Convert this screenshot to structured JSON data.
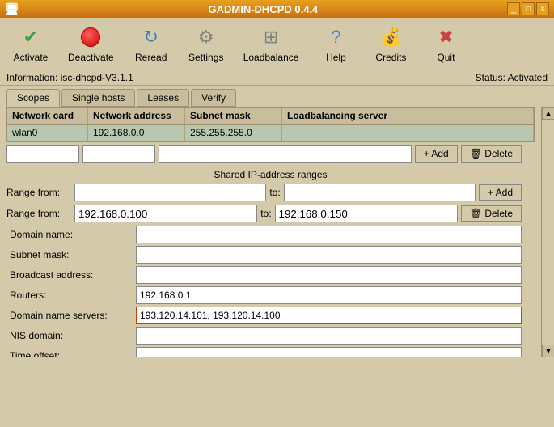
{
  "window": {
    "title": "GADMIN-DHCPD 0.4.4",
    "controls": [
      "_",
      "□",
      "×"
    ]
  },
  "toolbar": {
    "buttons": [
      {
        "id": "activate",
        "label": "Activate",
        "icon": "✔"
      },
      {
        "id": "deactivate",
        "label": "Deactivate",
        "icon": "●"
      },
      {
        "id": "reread",
        "label": "Reread",
        "icon": "↻"
      },
      {
        "id": "settings",
        "label": "Settings",
        "icon": "⚙"
      },
      {
        "id": "loadbalance",
        "label": "Loadbalance",
        "icon": "⊞"
      },
      {
        "id": "help",
        "label": "Help",
        "icon": "?"
      },
      {
        "id": "credits",
        "label": "Credits",
        "icon": "¤"
      },
      {
        "id": "quit",
        "label": "Quit",
        "icon": "✖"
      }
    ]
  },
  "status": {
    "left": "Information: isc-dhcpd-V3.1.1",
    "right": "Status: Activated"
  },
  "tabs": [
    {
      "id": "scopes",
      "label": "Scopes",
      "active": true
    },
    {
      "id": "single-hosts",
      "label": "Single hosts"
    },
    {
      "id": "leases",
      "label": "Leases"
    },
    {
      "id": "verify",
      "label": "Verify"
    }
  ],
  "table": {
    "headers": [
      "Network card",
      "Network address",
      "Subnet mask",
      "Loadbalancing server"
    ],
    "rows": [
      {
        "card": "wlan0",
        "address": "192.168.0.0",
        "mask": "255.255.255.0",
        "server": ""
      }
    ]
  },
  "form": {
    "input1_placeholder": "",
    "input2_placeholder": "",
    "input3_placeholder": "",
    "add_label": "+ Add",
    "delete_label": "🗑 Delete",
    "shared_ip_title": "Shared IP-address ranges",
    "range_from_label": "Range from:",
    "range_to_label": "to:",
    "range1_from": "",
    "range1_to": "",
    "range2_from": "192.168.0.100",
    "range2_to": "192.168.0.150",
    "add2_label": "+ Add",
    "delete2_label": "🗑 Delete",
    "fields": [
      {
        "id": "domain-name",
        "label": "Domain name:",
        "value": "",
        "highlighted": false
      },
      {
        "id": "subnet-mask",
        "label": "Subnet mask:",
        "value": "",
        "highlighted": false
      },
      {
        "id": "broadcast-address",
        "label": "Broadcast address:",
        "value": "",
        "highlighted": false
      },
      {
        "id": "routers",
        "label": "Routers:",
        "value": "192.168.0.1",
        "highlighted": false
      },
      {
        "id": "domain-name-servers",
        "label": "Domain name servers:",
        "value": "193.120.14.101, 193.120.14.100",
        "highlighted": true
      },
      {
        "id": "nis-domain",
        "label": "NIS domain:",
        "value": "",
        "highlighted": false
      },
      {
        "id": "time-offset",
        "label": "Time offset:",
        "value": "",
        "highlighted": false
      }
    ]
  }
}
